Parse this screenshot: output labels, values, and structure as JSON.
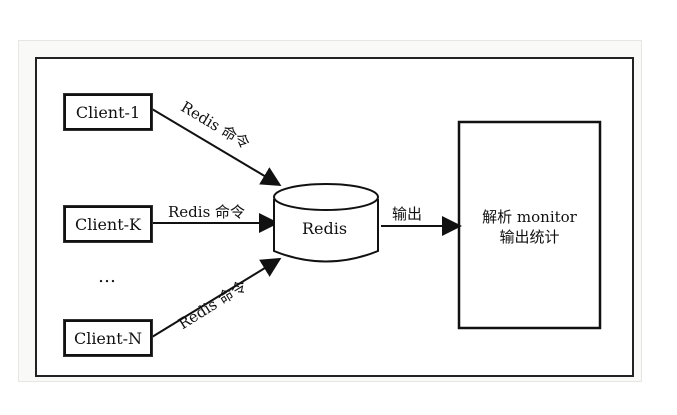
{
  "diagram": {
    "clients": {
      "client1": "Client-1",
      "clientK": "Client-K",
      "ellipsis": "…",
      "clientN": "Client-N"
    },
    "server": "Redis",
    "edge_labels": {
      "top": "Redis 命令",
      "middle": "Redis 命令",
      "bottom": "Redis 命令",
      "output": "输出"
    },
    "monitor": {
      "line1": "解析 monitor",
      "line2": "输出统计"
    }
  }
}
